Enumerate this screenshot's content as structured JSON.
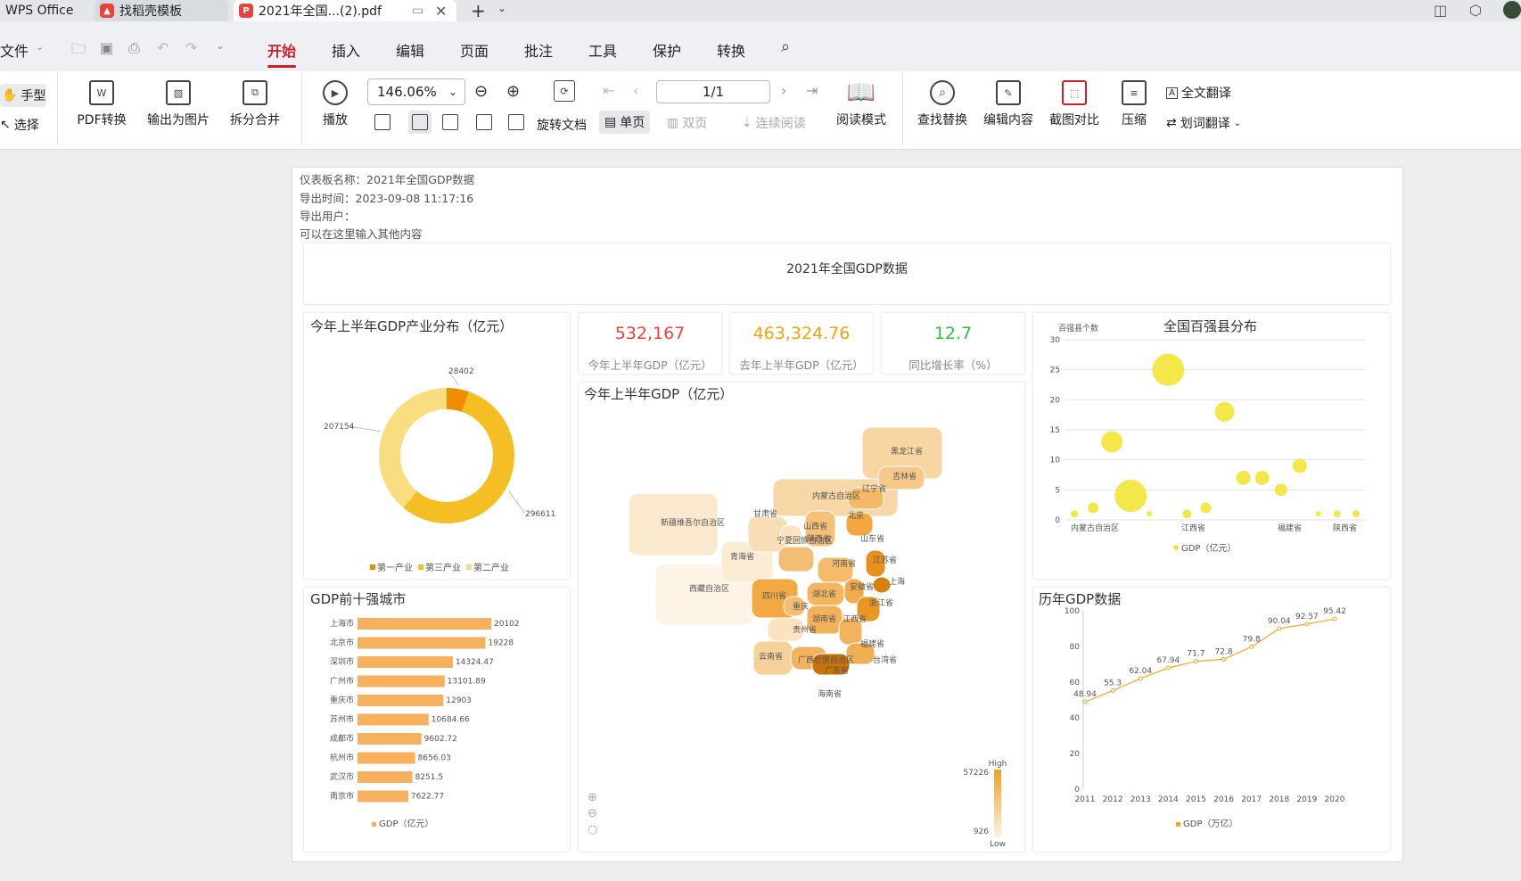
{
  "tabs": {
    "wps": "WPS Office",
    "template": "找稻壳模板",
    "pdf": "2021年全国...(2).pdf"
  },
  "menu": {
    "file": "文件",
    "items": [
      "开始",
      "插入",
      "编辑",
      "页面",
      "批注",
      "工具",
      "保护",
      "转换"
    ]
  },
  "ribbon": {
    "hand": "手型",
    "select": "选择",
    "pdf_convert": "PDF转换",
    "export_image": "输出为图片",
    "split_merge": "拆分合并",
    "play": "播放",
    "zoom": "146.06%",
    "rotate": "旋转文档",
    "single": "单页",
    "double": "双页",
    "continuous": "连续阅读",
    "page": "1/1",
    "read_mode": "阅读模式",
    "find_replace": "查找替换",
    "edit_content": "编辑内容",
    "compare": "截图对比",
    "compress": "压缩",
    "full_translate": "全文翻译",
    "word_translate": "划词翻译"
  },
  "doc": {
    "meta1": "仪表板名称：2021年全国GDP数据",
    "meta2": "导出时间：2023-09-08 11:17:16",
    "meta3": "导出用户：",
    "meta4": "可以在这里输入其他内容",
    "banner": "2021年全国GDP数据"
  },
  "kpis": [
    {
      "value": "532,167",
      "label": "今年上半年GDP（亿元）",
      "color": "#f0423c"
    },
    {
      "value": "463,324.76",
      "label": "去年上半年GDP（亿元）",
      "color": "#f5a20f"
    },
    {
      "value": "12.7",
      "label": "同比增长率（%）",
      "color": "#2cc23c"
    }
  ],
  "panels": {
    "donut_title": "今年上半年GDP产业分布（亿元）",
    "map_title": "今年上半年GDP（亿元）",
    "scatter_title": "全国百强县分布",
    "bar_title": "GDP前十强城市",
    "line_title": "历年GDP数据"
  },
  "chart_data": [
    {
      "type": "pie",
      "title": "今年上半年GDP产业分布（亿元）",
      "slices": [
        {
          "name": "第一产业",
          "value": 28402,
          "color": "#f08c00"
        },
        {
          "name": "第三产业",
          "value": 296611,
          "color": "#f5bf24"
        },
        {
          "name": "第二产业",
          "value": 207154,
          "color": "#f9dd80"
        }
      ],
      "legend": "bottom"
    },
    {
      "type": "scatter",
      "title": "全国百强县分布",
      "ylabel": "百强县个数",
      "ylim": [
        0,
        30
      ],
      "yticks": [
        0,
        5,
        10,
        15,
        20,
        25,
        30
      ],
      "xtick_labels": [
        "内蒙古自治区",
        "江西省",
        "福建省",
        "陕西省"
      ],
      "legend_label": "GDP（亿元）",
      "color": "#f2e53a",
      "points": [
        {
          "x": 1,
          "y": 1,
          "size": 4
        },
        {
          "x": 2,
          "y": 2,
          "size": 6
        },
        {
          "x": 3,
          "y": 13,
          "size": 12
        },
        {
          "x": 4,
          "y": 4,
          "size": 18
        },
        {
          "x": 5,
          "y": 1,
          "size": 3
        },
        {
          "x": 6,
          "y": 25,
          "size": 18
        },
        {
          "x": 7,
          "y": 1,
          "size": 5
        },
        {
          "x": 8,
          "y": 2,
          "size": 6
        },
        {
          "x": 9,
          "y": 18,
          "size": 11
        },
        {
          "x": 10,
          "y": 7,
          "size": 8
        },
        {
          "x": 11,
          "y": 7,
          "size": 8
        },
        {
          "x": 12,
          "y": 5,
          "size": 7
        },
        {
          "x": 13,
          "y": 9,
          "size": 8
        },
        {
          "x": 14,
          "y": 1,
          "size": 3
        },
        {
          "x": 15,
          "y": 1,
          "size": 4
        },
        {
          "x": 16,
          "y": 1,
          "size": 4
        }
      ]
    },
    {
      "type": "bar",
      "title": "GDP前十强城市",
      "categories": [
        "上海市",
        "北京市",
        "深圳市",
        "广州市",
        "重庆市",
        "苏州市",
        "成都市",
        "杭州市",
        "武汉市",
        "南京市"
      ],
      "values": [
        20102,
        19228,
        14324.47,
        13101.89,
        12903,
        10684.66,
        9602.72,
        8656.03,
        8251.5,
        7622.77
      ],
      "value_labels": [
        "20102",
        "19228",
        "14324.47",
        "13101.89",
        "12903",
        "10684.66",
        "9602.72",
        "8656.03",
        "8251.5",
        "7622.77"
      ],
      "legend_label": "GDP（亿元）",
      "color": "#f7b15e"
    },
    {
      "type": "line",
      "title": "历年GDP数据",
      "x": [
        "2011",
        "2012",
        "2013",
        "2014",
        "2015",
        "2016",
        "2017",
        "2018",
        "2019",
        "2020"
      ],
      "values": [
        48.94,
        55.3,
        62.04,
        67.94,
        71.7,
        72.8,
        79.8,
        90.04,
        92.57,
        95.42
      ],
      "value_labels": [
        "48.94",
        "55.3",
        "62.04",
        "67.94",
        "71.7",
        "72.8",
        "79.8",
        "90.04",
        "92.57",
        "95.42"
      ],
      "ylim": [
        0,
        100
      ],
      "yticks": [
        0,
        20,
        40,
        60,
        80,
        100
      ],
      "legend_label": "GDP（万亿）",
      "color": "#f5a623"
    }
  ],
  "map": {
    "regions": [
      "新疆维吾尔自治区",
      "西藏自治区",
      "青海省",
      "甘肃省",
      "内蒙古自治区",
      "黑龙江省",
      "吉林省",
      "辽宁省",
      "北京",
      "山西省",
      "宁夏回族自治区",
      "陕西省",
      "山东省",
      "河南省",
      "江苏省",
      "四川省",
      "湖北省",
      "安徽省",
      "上海",
      "浙江省",
      "重庆",
      "湖南省",
      "江西省",
      "贵州省",
      "福建省",
      "云南省",
      "广西壮族自治区",
      "广东省",
      "台湾省",
      "海南省"
    ],
    "legend_high": "High",
    "legend_low": "Low",
    "legend_max": "57226",
    "legend_min": "926"
  }
}
